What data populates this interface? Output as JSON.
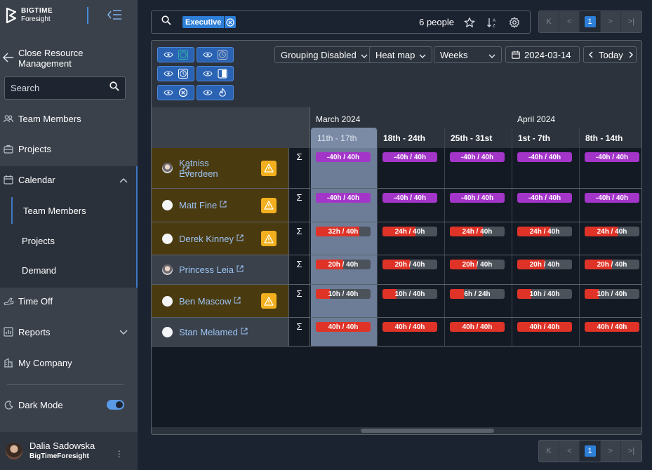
{
  "brand": {
    "line1": "BIGTIME",
    "line2": "Foresight"
  },
  "sidebar": {
    "close_label": "Close Resource Management",
    "search_placeholder": "Search",
    "items": [
      {
        "label": "Team Members",
        "icon": "team-icon"
      },
      {
        "label": "Projects",
        "icon": "projects-icon"
      },
      {
        "label": "Calendar",
        "icon": "calendar-icon"
      },
      {
        "label": "Time Off",
        "icon": "plane-icon"
      },
      {
        "label": "Reports",
        "icon": "reports-icon"
      },
      {
        "label": "My Company",
        "icon": "company-icon"
      }
    ],
    "calendar_sub": [
      "Team Members",
      "Projects",
      "Demand"
    ],
    "dark_mode_label": "Dark Mode",
    "dark_mode_on": true
  },
  "user": {
    "name": "Dalia Sadowska",
    "company": "BigTimeForesight"
  },
  "topbar": {
    "filter_chip": "Executive",
    "people_count": "6 people"
  },
  "pager": {
    "first": "K",
    "prev": "<",
    "page": "1",
    "next": ">",
    "last": ">|"
  },
  "controls": {
    "grouping": "Grouping Disabled",
    "view": "Heat map",
    "period": "Weeks",
    "date": "2024-03-14",
    "today": "Today"
  },
  "calendar": {
    "months": [
      {
        "label": "March 2024"
      },
      {
        "label": "April 2024"
      }
    ],
    "weeks": [
      "11th - 17th",
      "18th - 24th",
      "25th - 31st",
      "1st - 7th",
      "8th - 14th"
    ],
    "selected_week": 0,
    "sigma": "Σ",
    "rows": [
      {
        "name": "Katniss Everdeen",
        "warn": true,
        "avatar": "photo",
        "cells": [
          {
            "label": "-40h / 40h",
            "type": "purple"
          },
          {
            "label": "-40h / 40h",
            "type": "purple"
          },
          {
            "label": "-40h / 40h",
            "type": "purple"
          },
          {
            "label": "-40h / 40h",
            "type": "purple"
          },
          {
            "label": "-40h / 40h",
            "type": "purple"
          }
        ]
      },
      {
        "name": "Matt Fine",
        "warn": true,
        "avatar": "blank",
        "cells": [
          {
            "label": "-40h / 40h",
            "type": "purple"
          },
          {
            "label": "-40h / 40h",
            "type": "purple"
          },
          {
            "label": "-40h / 40h",
            "type": "purple"
          },
          {
            "label": "-40h / 40h",
            "type": "purple"
          },
          {
            "label": "-40h / 40h",
            "type": "purple"
          }
        ]
      },
      {
        "name": "Derek Kinney",
        "warn": true,
        "avatar": "blank",
        "cells": [
          {
            "label": "32h / 40h",
            "type": "mixed",
            "fill": 0.8
          },
          {
            "label": "24h / 40h",
            "type": "mixed",
            "fill": 0.6
          },
          {
            "label": "24h / 40h",
            "type": "mixed",
            "fill": 0.6
          },
          {
            "label": "24h / 40h",
            "type": "mixed",
            "fill": 0.6
          },
          {
            "label": "24h / 40h",
            "type": "mixed",
            "fill": 0.6
          }
        ]
      },
      {
        "name": "Princess Leia",
        "warn": false,
        "avatar": "photo",
        "cells": [
          {
            "label": "20h / 40h",
            "type": "mixed",
            "fill": 0.5
          },
          {
            "label": "20h / 40h",
            "type": "mixed",
            "fill": 0.5
          },
          {
            "label": "20h / 40h",
            "type": "mixed",
            "fill": 0.5
          },
          {
            "label": "20h / 40h",
            "type": "mixed",
            "fill": 0.5
          },
          {
            "label": "20h / 40h",
            "type": "mixed",
            "fill": 0.5
          }
        ]
      },
      {
        "name": "Ben Mascow",
        "warn": true,
        "avatar": "blank",
        "cells": [
          {
            "label": "10h / 40h",
            "type": "mixed",
            "fill": 0.25
          },
          {
            "label": "10h / 40h",
            "type": "mixed",
            "fill": 0.25
          },
          {
            "label": "6h / 24h",
            "type": "mixed",
            "fill": 0.25
          },
          {
            "label": "10h / 40h",
            "type": "mixed",
            "fill": 0.25
          },
          {
            "label": "10h / 40h",
            "type": "mixed",
            "fill": 0.25
          }
        ]
      },
      {
        "name": "Stan Melamed",
        "warn": false,
        "avatar": "blank",
        "cells": [
          {
            "label": "40h / 40h",
            "type": "red"
          },
          {
            "label": "40h / 40h",
            "type": "red"
          },
          {
            "label": "40h / 40h",
            "type": "red"
          },
          {
            "label": "40h / 40h",
            "type": "red"
          },
          {
            "label": "40h / 40h",
            "type": "red"
          }
        ]
      }
    ]
  }
}
